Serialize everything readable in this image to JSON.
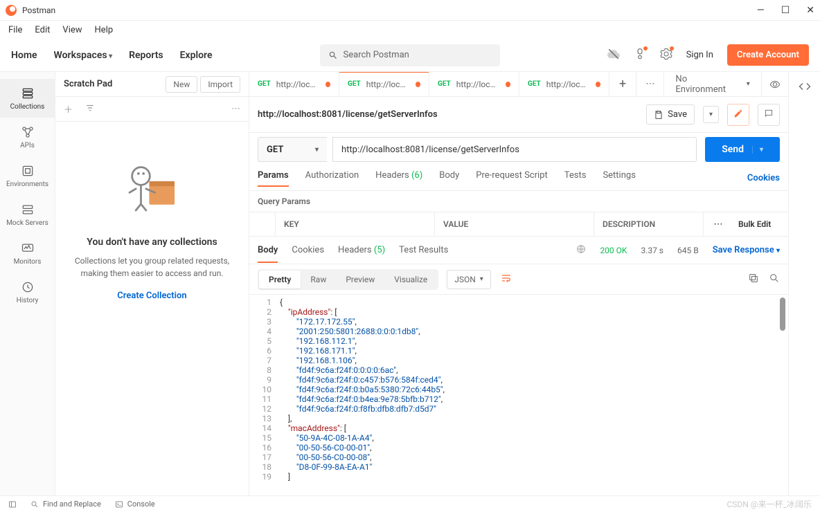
{
  "titlebar": {
    "title": "Postman"
  },
  "menubar": [
    "File",
    "Edit",
    "View",
    "Help"
  ],
  "toolbar": {
    "nav": [
      "Home",
      "Workspaces",
      "Reports",
      "Explore"
    ],
    "search_placeholder": "Search Postman",
    "signin": "Sign In",
    "create_account": "Create Account"
  },
  "sidebar": {
    "items": [
      {
        "label": "Collections"
      },
      {
        "label": "APIs"
      },
      {
        "label": "Environments"
      },
      {
        "label": "Mock Servers"
      },
      {
        "label": "Monitors"
      },
      {
        "label": "History"
      }
    ]
  },
  "left_panel": {
    "title": "Scratch Pad",
    "btn_new": "New",
    "btn_import": "Import",
    "empty_title": "You don't have any collections",
    "empty_desc": "Collections let you group related requests, making them easier to access and run.",
    "empty_link": "Create Collection"
  },
  "tabs": [
    {
      "method": "GET",
      "label": "http://local...",
      "active": false,
      "dirty": true
    },
    {
      "method": "GET",
      "label": "http://local...",
      "active": true,
      "dirty": true
    },
    {
      "method": "GET",
      "label": "http://local...",
      "active": false,
      "dirty": true
    },
    {
      "method": "GET",
      "label": "http://local...",
      "active": false,
      "dirty": true
    }
  ],
  "environment": "No Environment",
  "request": {
    "title": "http://localhost:8081/license/getServerInfos",
    "save": "Save",
    "method": "GET",
    "url": "http://localhost:8081/license/getServerInfos",
    "send": "Send",
    "tabs": {
      "params": "Params",
      "auth": "Authorization",
      "headers": "Headers",
      "headers_count": "(6)",
      "body": "Body",
      "prereq": "Pre-request Script",
      "tests": "Tests",
      "settings": "Settings",
      "cookies": "Cookies"
    },
    "query_header": "Query Params",
    "cols": {
      "key": "KEY",
      "value": "VALUE",
      "desc": "DESCRIPTION",
      "bulk": "Bulk Edit"
    }
  },
  "response": {
    "tabs": {
      "body": "Body",
      "cookies": "Cookies",
      "headers": "Headers",
      "headers_count": "(5)",
      "test_results": "Test Results"
    },
    "status": "200 OK",
    "time": "3.37 s",
    "size": "645 B",
    "save_response": "Save Response",
    "view": {
      "pretty": "Pretty",
      "raw": "Raw",
      "preview": "Preview",
      "visualize": "Visualize"
    },
    "format": "JSON",
    "code_lines": [
      {
        "n": 1,
        "html": "<span class='tok-punc'>{</span>"
      },
      {
        "n": 2,
        "html": "    <span class='tok-key'>\"ipAddress\"</span><span class='tok-punc'>: [</span>"
      },
      {
        "n": 3,
        "html": "        <span class='tok-str'>\"172.17.172.55\"</span><span class='tok-punc'>,</span>"
      },
      {
        "n": 4,
        "html": "        <span class='tok-str'>\"2001:250:5801:2688:0:0:0:1db8\"</span><span class='tok-punc'>,</span>"
      },
      {
        "n": 5,
        "html": "        <span class='tok-str'>\"192.168.112.1\"</span><span class='tok-punc'>,</span>"
      },
      {
        "n": 6,
        "html": "        <span class='tok-str'>\"192.168.171.1\"</span><span class='tok-punc'>,</span>"
      },
      {
        "n": 7,
        "html": "        <span class='tok-str'>\"192.168.1.106\"</span><span class='tok-punc'>,</span>"
      },
      {
        "n": 8,
        "html": "        <span class='tok-str'>\"fd4f:9c6a:f24f:0:0:0:0:6ac\"</span><span class='tok-punc'>,</span>"
      },
      {
        "n": 9,
        "html": "        <span class='tok-str'>\"fd4f:9c6a:f24f:0:c457:b576:584f:ced4\"</span><span class='tok-punc'>,</span>"
      },
      {
        "n": 10,
        "html": "        <span class='tok-str'>\"fd4f:9c6a:f24f:0:b0a5:5380:72c6:44b5\"</span><span class='tok-punc'>,</span>"
      },
      {
        "n": 11,
        "html": "        <span class='tok-str'>\"fd4f:9c6a:f24f:0:b4ea:9e78:5bfb:b712\"</span><span class='tok-punc'>,</span>"
      },
      {
        "n": 12,
        "html": "        <span class='tok-str'>\"fd4f:9c6a:f24f:0:f8fb:dfb8:dfb7:d5d7\"</span>"
      },
      {
        "n": 13,
        "html": "    <span class='tok-punc'>],</span>"
      },
      {
        "n": 14,
        "html": "    <span class='tok-key'>\"macAddress\"</span><span class='tok-punc'>: [</span>"
      },
      {
        "n": 15,
        "html": "        <span class='tok-str'>\"50-9A-4C-08-1A-A4\"</span><span class='tok-punc'>,</span>"
      },
      {
        "n": 16,
        "html": "        <span class='tok-str'>\"00-50-56-C0-00-01\"</span><span class='tok-punc'>,</span>"
      },
      {
        "n": 17,
        "html": "        <span class='tok-str'>\"00-50-56-C0-00-08\"</span><span class='tok-punc'>,</span>"
      },
      {
        "n": 18,
        "html": "        <span class='tok-str'>\"D8-0F-99-8A-EA-A1\"</span>"
      },
      {
        "n": 19,
        "html": "    <span class='tok-punc'>]</span>"
      }
    ]
  },
  "statusbar": {
    "find": "Find and Replace",
    "console": "Console",
    "watermark": "CSDN @来一杯_冰阔乐"
  }
}
